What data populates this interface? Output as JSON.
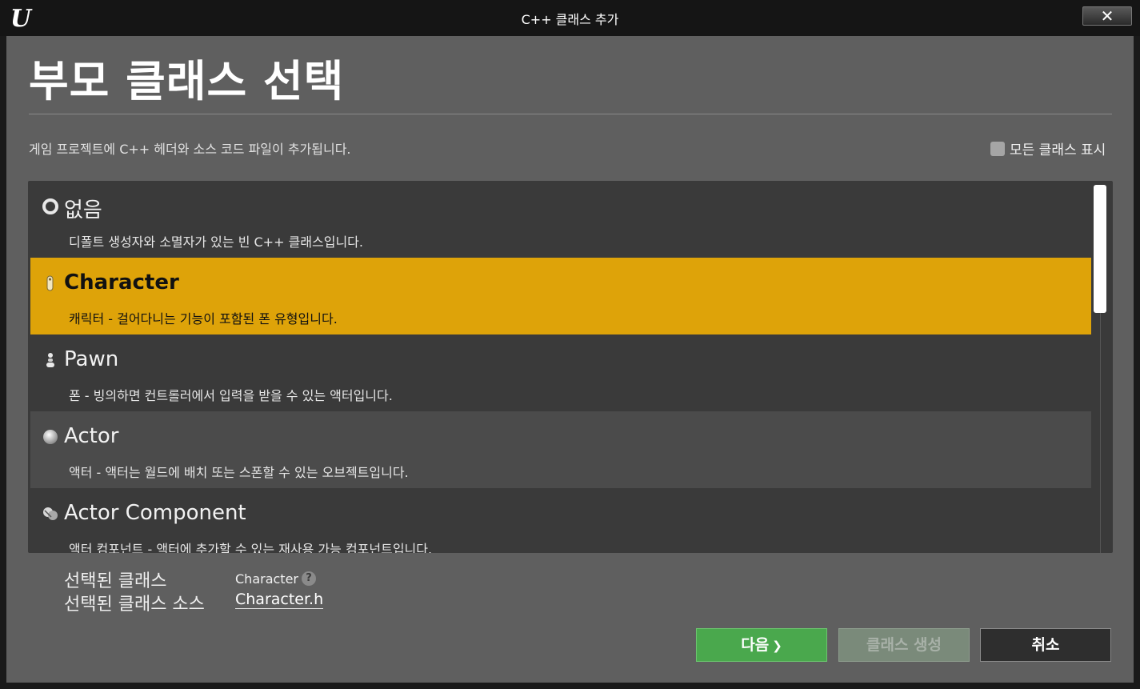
{
  "window": {
    "title": "C++ 클래스 추가",
    "close_label": "✕",
    "logo_text": "U"
  },
  "header": {
    "title": "부모 클래스 선택",
    "description": "게임 프로젝트에 C++ 헤더와 소스 코드 파일이 추가됩니다.",
    "show_all_label": "모든 클래스 표시",
    "show_all_checked": false
  },
  "class_list": [
    {
      "name": "없음",
      "desc": "디폴트 생성자와 소멸자가 있는 빈 C++ 클래스입니다.",
      "icon": "empty-circle-icon",
      "selected": false
    },
    {
      "name": "Character",
      "desc": "캐릭터 - 걸어다니는 기능이 포함된 폰 유형입니다.",
      "icon": "character-icon",
      "selected": true
    },
    {
      "name": "Pawn",
      "desc": "폰 - 빙의하면 컨트롤러에서 입력을 받을 수 있는 액터입니다.",
      "icon": "pawn-icon",
      "selected": false
    },
    {
      "name": "Actor",
      "desc": "액터 - 액터는 월드에 배치 또는 스폰할 수 있는 오브젝트입니다.",
      "icon": "actor-sphere-icon",
      "selected": false
    },
    {
      "name": "Actor Component",
      "desc": "액터 컴포넌트 - 액터에 추가할 수 있는 재사용 가능 컴포넌트입니다.",
      "icon": "actor-component-icon",
      "selected": false
    }
  ],
  "selection": {
    "class_label": "선택된 클래스",
    "class_value": "Character",
    "source_label": "선택된 클래스 소스",
    "source_value": "Character.h"
  },
  "buttons": {
    "next": "다음",
    "next_chevron": "❯",
    "create": "클래스 생성",
    "cancel": "취소"
  },
  "colors": {
    "selected_row": "#dea309",
    "next_button": "#4aa84d"
  }
}
